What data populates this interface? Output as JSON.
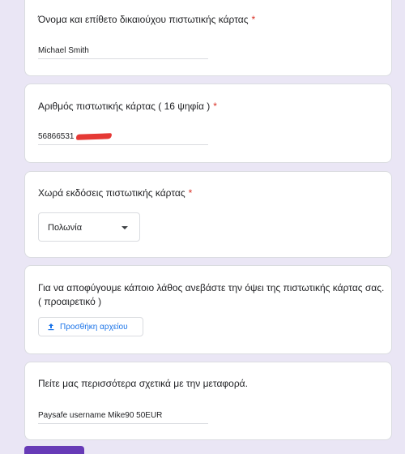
{
  "questions": [
    {
      "title": "Όνομα και επίθετο δικαιούχου πιστωτικής κάρτας",
      "required_mark": "*",
      "answer": "Michael Smith"
    },
    {
      "title": "Αριθμός πιστωτικής κάρτας ( 16 ψηφία )",
      "required_mark": "*",
      "answer_visible": "56866531"
    },
    {
      "title": "Χωρά εκδόσεις πιστωτικής κάρτας",
      "required_mark": "*",
      "selected": "Πολωνία"
    },
    {
      "title_line1": "Για να αποφύγουμε κάποιο λάθος ανεβάστε την όψει  της πιστωτικής κάρτας σας.",
      "title_line2": "( προαιρετικό )",
      "button": "Προσθήκη αρχείου"
    },
    {
      "title": "Πείτε μας περισσότερα σχετικά με την μεταφορά.",
      "answer": "Paysafe username Mike90 50EUR"
    }
  ],
  "colors": {
    "background": "#eae6f5",
    "required": "#d93025",
    "accent": "#1a73e8",
    "redaction": "#e53935"
  },
  "icons": [
    "upload-icon",
    "dropdown-caret-icon"
  ]
}
